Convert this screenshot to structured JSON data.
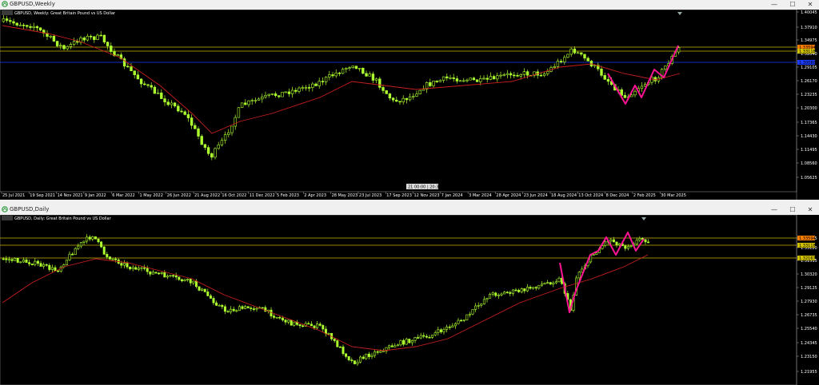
{
  "weekly": {
    "window_title": "GBPUSD,Weekly",
    "info": "GBPUSD, Weekly:  Great Britain Pound vs US Dollar",
    "price_labels": [
      "1.40045",
      "1.37910",
      "1.34975",
      "1.32040",
      "1.29105",
      "1.26170",
      "1.23235",
      "1.20300",
      "1.17365",
      "1.14430",
      "1.11495",
      "1.08560",
      "1.05625"
    ],
    "tag_prices": [
      "1.33594",
      "1.33118",
      "1.30080"
    ],
    "date_labels": [
      "25 Jul 2021",
      "19 Sep 2021",
      "14 Nov 2021",
      "9 Jan 2022",
      "6 Mar 2022",
      "1 May 2022",
      "26 Jun 2022",
      "21 Aug 2022",
      "16 Oct 2022",
      "11 Dec 2022",
      "5 Feb 2023",
      "2 Apr 2023",
      "28 May 2023",
      "23 Jul 2023",
      "17 Sep 2023",
      "12 Nov 2023",
      "7 Jan 2024",
      "3 Mar 2024",
      "28 Apr 2024",
      "23 Jun 2024",
      "18 Aug 2024",
      "13 Oct 2024",
      "8 Dec 2024",
      "2 Feb 2025",
      "30 Mar 2025"
    ],
    "time_badge": "21 00:00 | 20:36",
    "colors": {
      "bull": "#adff2f",
      "ma": "#c81e1e",
      "pattern": "#ff1493",
      "hline": "#c8b400",
      "blueline": "#1e3cff"
    }
  },
  "daily": {
    "window_title": "GBPUSD,Daily",
    "info": "GBPUSD, Daily:  Great Britain Pound vs US Dollar",
    "price_labels": [
      "1.33905",
      "1.33120",
      "1.31515",
      "1.30320",
      "1.29125",
      "1.27930",
      "1.26735",
      "1.25540",
      "1.24345",
      "1.23150",
      "1.21955"
    ],
    "tag_prices": [
      "1.33594",
      "1.33118",
      "1.32167"
    ],
    "colors": {
      "bull": "#adff2f",
      "ma": "#c81e1e",
      "pattern": "#ff1493",
      "hline": "#c8b400"
    }
  },
  "controls": {
    "minimize": "—",
    "maximize": "☐",
    "close": "✕"
  }
}
